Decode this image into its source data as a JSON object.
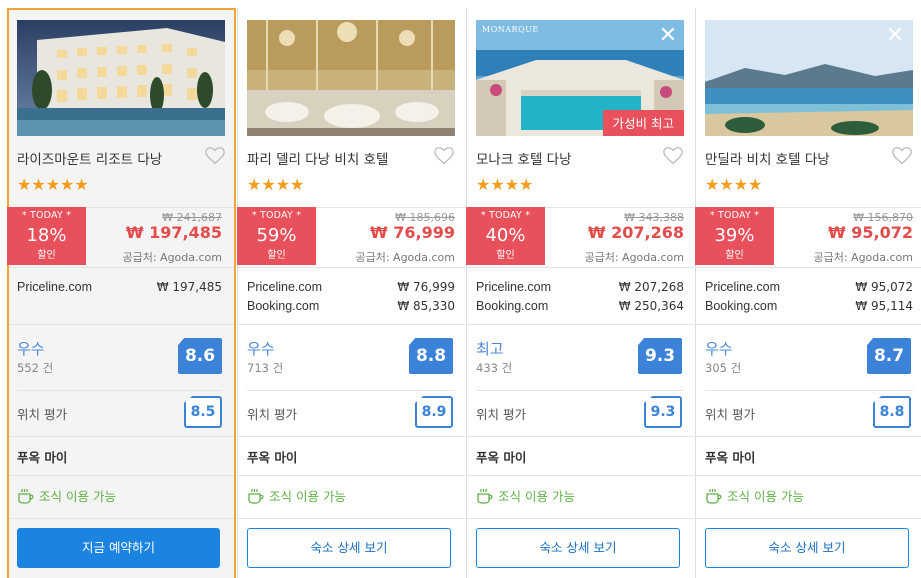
{
  "cards": [
    {
      "name": "라이즈마운트 리조트 다낭",
      "stars": "★★★★★",
      "today": "* TODAY *",
      "discount": "18%",
      "off_label": "할인",
      "old_price": "₩ 241,687",
      "new_price": "₩ 197,485",
      "supplier": "공급처: Agoda.com",
      "offers": [
        {
          "provider": "Priceline.com",
          "price": "₩ 197,485"
        }
      ],
      "rating_word": "우수",
      "review_count": "552 건",
      "score": "8.6",
      "location_label": "위치 평가",
      "location_score": "8.5",
      "area": "푸옥 마이",
      "breakfast": "조식 이용 가능",
      "button": "지금 예약하기",
      "ribbon": "",
      "close": ""
    },
    {
      "name": "파리 델리 다낭 비치 호텔",
      "stars": "★★★★",
      "today": "* TODAY *",
      "discount": "59%",
      "off_label": "할인",
      "old_price": "₩ 185,696",
      "new_price": "₩ 76,999",
      "supplier": "공급처: Agoda.com",
      "offers": [
        {
          "provider": "Priceline.com",
          "price": "₩ 76,999"
        },
        {
          "provider": "Booking.com",
          "price": "₩ 85,330"
        }
      ],
      "rating_word": "우수",
      "review_count": "713 건",
      "score": "8.8",
      "location_label": "위치 평가",
      "location_score": "8.9",
      "area": "푸옥 마이",
      "breakfast": "조식 이용 가능",
      "button": "숙소 상세 보기",
      "ribbon": "",
      "close": ""
    },
    {
      "name": "모나크 호텔 다낭",
      "stars": "★★★★",
      "today": "* TODAY *",
      "discount": "40%",
      "off_label": "할인",
      "old_price": "₩ 343,388",
      "new_price": "₩ 207,268",
      "supplier": "공급처: Agoda.com",
      "offers": [
        {
          "provider": "Priceline.com",
          "price": "₩ 207,268"
        },
        {
          "provider": "Booking.com",
          "price": "₩ 250,364"
        }
      ],
      "rating_word": "최고",
      "review_count": "433 건",
      "score": "9.3",
      "location_label": "위치 평가",
      "location_score": "9.3",
      "area": "푸옥 마이",
      "breakfast": "조식 이용 가능",
      "button": "숙소 상세 보기",
      "ribbon": "가성비 최고",
      "close": "✕",
      "photo_brand": "MONARQUE"
    },
    {
      "name": "만딜라 비치 호텔 다낭",
      "stars": "★★★★",
      "today": "* TODAY *",
      "discount": "39%",
      "off_label": "할인",
      "old_price": "₩ 156,870",
      "new_price": "₩ 95,072",
      "supplier": "공급처: Agoda.com",
      "offers": [
        {
          "provider": "Priceline.com",
          "price": "₩ 95,072"
        },
        {
          "provider": "Booking.com",
          "price": "₩ 95,114"
        }
      ],
      "rating_word": "우수",
      "review_count": "305 건",
      "score": "8.7",
      "location_label": "위치 평가",
      "location_score": "8.8",
      "area": "푸옥 마이",
      "breakfast": "조식 이용 가능",
      "button": "숙소 상세 보기",
      "ribbon": "",
      "close": "✕"
    }
  ],
  "colors": {
    "deal_red": "#e8505b",
    "price_red": "#e44b4b",
    "rating_blue": "#3b82d9",
    "star_orange": "#f49c1c",
    "selected_border": "#f0a53a",
    "breakfast_green": "#5fb047"
  }
}
